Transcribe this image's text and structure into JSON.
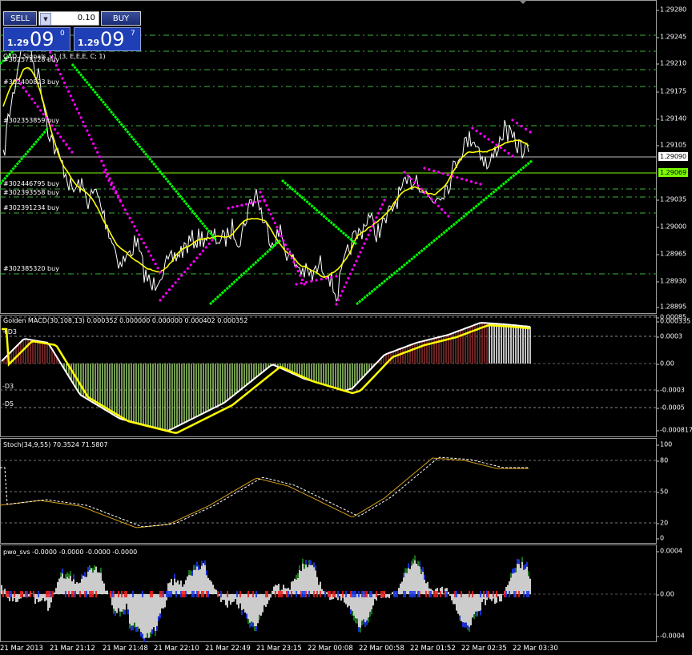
{
  "trade_panel": {
    "sell_label": "SELL",
    "buy_label": "BUY",
    "lot_value": "0.10",
    "bid": {
      "prefix": "1.29",
      "big": "09",
      "sup": "0"
    },
    "ask": {
      "prefix": "1.29",
      "big": "09",
      "sup": "7"
    }
  },
  "main": {
    "indicator_label": "CAD...Signals_v1 (3, E,E,E, C; 1)",
    "price_ticks": [
      "1.29280",
      "1.29245",
      "1.29210",
      "1.29175",
      "1.29140",
      "1.29105",
      "1.29035",
      "1.29000",
      "1.28965",
      "1.28930",
      "1.28895"
    ],
    "current_price": "1.29090",
    "line_price": "1.29069",
    "orders": [
      "#302571128 buy",
      "#302400823 buy",
      "#302353859 buy",
      "#302446795 buy",
      "#302393558 buy",
      "#302391234 buy",
      "#302385320 buy"
    ],
    "colors": {
      "price": "#ffffff",
      "ma": "#ffff00",
      "sar_up": "#00ff00",
      "sar_dn": "#ff00ff",
      "levels": "#3cb43c",
      "line": "#7cfc00"
    }
  },
  "macd": {
    "label": "Golden MACD(30,108,13) 0.000352 0.000000 0.000000 0.000402 0.000352",
    "level_labels": [
      "+D3",
      "-D3",
      "-D5"
    ],
    "ticks": [
      "0.0003",
      "0.00",
      "-0.0003",
      "-0.0005",
      "-0.000817"
    ],
    "top_ticks": [
      "0.00085",
      "0.000335"
    ]
  },
  "stoch": {
    "label": "Stoch(34,9,55) 70.3524 71.5807",
    "ticks": [
      "100",
      "80",
      "50",
      "20",
      "0"
    ]
  },
  "pwo": {
    "label": "pwo_svs -0.0000 -0.0000 -0.0000 -0.0000",
    "ticks": [
      "0.0004",
      "0.00",
      "-0.0004"
    ]
  },
  "time_axis": [
    "21 Mar 2013",
    "21 Mar 21:12",
    "21 Mar 21:48",
    "21 Mar 22:10",
    "21 Mar 22:49",
    "21 Mar 23:15",
    "22 Mar 00:08",
    "22 Mar 00:58",
    "22 Mar 01:52",
    "22 Mar 02:35",
    "22 Mar 03:30"
  ]
}
